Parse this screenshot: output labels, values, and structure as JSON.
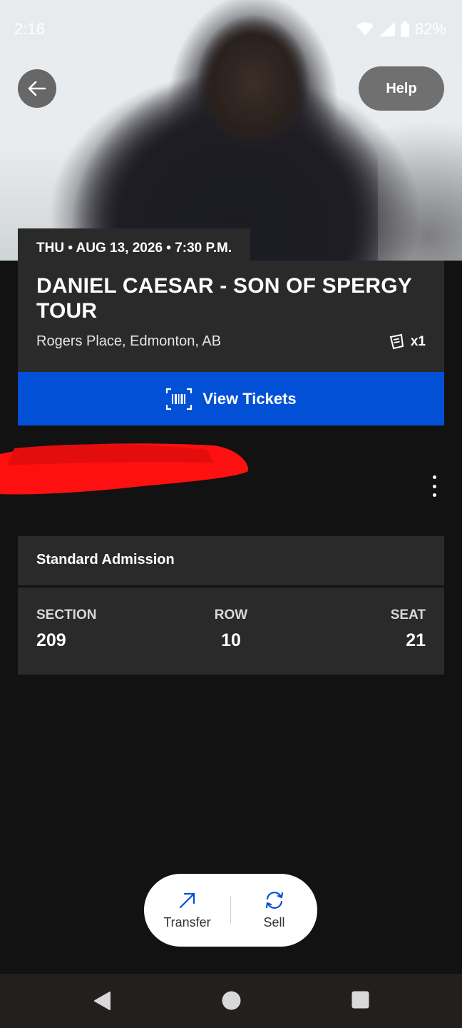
{
  "status": {
    "time": "2:16",
    "battery": "82%"
  },
  "header": {
    "help_label": "Help"
  },
  "event": {
    "date": "THU • AUG 13, 2026 • 7:30 P.M.",
    "title": "DANIEL CAESAR - SON OF SPERGY TOUR",
    "venue": "Rogers Place, Edmonton, AB",
    "ticket_count": "x1"
  },
  "view_tickets_label": "View Tickets",
  "seat": {
    "type": "Standard Admission",
    "section_label": "SECTION",
    "section": "209",
    "row_label": "ROW",
    "row": "10",
    "seat_label": "SEAT",
    "seat_number": "21"
  },
  "actions": {
    "transfer": "Transfer",
    "sell": "Sell"
  },
  "colors": {
    "accent": "#0250d6",
    "card": "#2a2a2a",
    "background": "#121212",
    "redaction": "#ff0000"
  },
  "icons": [
    "back-arrow-icon",
    "wifi-icon",
    "signal-icon",
    "battery-icon",
    "ticket-icon",
    "barcode-icon",
    "more-vertical-icon",
    "transfer-arrow-icon",
    "sell-refresh-icon",
    "nav-back-icon",
    "nav-home-icon",
    "nav-recents-icon"
  ]
}
